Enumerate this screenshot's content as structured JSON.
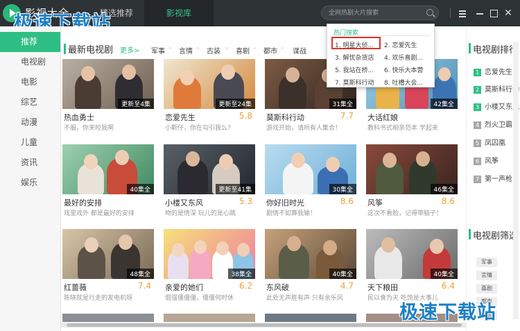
{
  "app": {
    "title": "影视大全"
  },
  "watermark": "极速下载站",
  "top_tabs": [
    "精选推荐",
    "影视库"
  ],
  "search": {
    "placeholder": "全网热剧大片搜索"
  },
  "sidebar": {
    "items": [
      {
        "label": "推荐",
        "active": true
      },
      {
        "label": "电视剧"
      },
      {
        "label": "电影"
      },
      {
        "label": "综艺"
      },
      {
        "label": "动漫"
      },
      {
        "label": "儿童"
      },
      {
        "label": "资讯"
      },
      {
        "label": "娱乐"
      }
    ]
  },
  "section": {
    "title": "最新电视剧",
    "more": "更多>",
    "filters": [
      "军事",
      "言情",
      "古装",
      "喜剧",
      "都市",
      "谍战"
    ],
    "filter_sep": "·"
  },
  "cards": [
    {
      "title": "热血勇士",
      "rating": "",
      "desc": "不服，你来咬我啊",
      "badge": "更新至4集"
    },
    {
      "title": "恋爱先生",
      "rating": "5.8",
      "desc": "小靳仔，你在勾引我么？",
      "badge": "更新至24集"
    },
    {
      "title": "莫斯科行动",
      "rating": "7.7",
      "desc": "游戏开始，请所有人集合！",
      "badge": "31集全"
    },
    {
      "title": "大话红娘",
      "rating": "",
      "desc": "教科书式相亲范本 学起来",
      "badge": "42集全"
    },
    {
      "title": "最好的安排",
      "rating": "",
      "desc": "戏里戏外 都是最好的安排",
      "badge": "40集全"
    },
    {
      "title": "小楼又东风",
      "rating": "5.3",
      "desc": "吻的是情深 玩儿的是心跳",
      "badge": "更新至41集"
    },
    {
      "title": "你好旧时光",
      "rating": "8.6",
      "desc": "剧情不如算我输！",
      "badge": "30集全"
    },
    {
      "title": "风筝",
      "rating": "8.6",
      "desc": "这次不看脸，记得带脑子！",
      "badge": "46集全"
    },
    {
      "title": "红蔷薇",
      "rating": "7.4",
      "desc": "陈晓就是行走的发电机呀",
      "badge": "48集全"
    },
    {
      "title": "亲爱的她们",
      "rating": "6.2",
      "desc": "倔强僵僵僵，僵僵何时休",
      "badge": "38集全"
    },
    {
      "title": "东风破",
      "rating": "4.7",
      "desc": "此处无声胜有声 只有余乐风",
      "badge": "40集全"
    },
    {
      "title": "天下粮田",
      "rating": "6.4",
      "desc": "民以食为天 吃饱是大事儿",
      "badge": "40集全"
    }
  ],
  "right_panel": {
    "rank_title": "电视剧排行",
    "rank_items": [
      "恋爱先生",
      "莫斯科行动",
      "小楼又东风",
      "烈火卫霸",
      "凤囚凰",
      "风筝",
      "第一声枪"
    ],
    "rank_hot_count": 3,
    "cat_title": "电视剧筛选",
    "tags": [
      "军事",
      "言情",
      "喜剧",
      "都市",
      "古装"
    ]
  },
  "dropdown": {
    "title": "热门搜索",
    "items": [
      "1. 明星大侦...",
      "2. 恋爱先生",
      "3. 解忧杂货店",
      "4. 欢乐喜剧...",
      "5. 我站在桥...",
      "6. 快乐大本营",
      "7. 莫斯科行动",
      "8. 吐槽大会..."
    ]
  },
  "colors": {
    "accent": "#2ebf85",
    "titlebar": "#2d3235",
    "rating": "#e8a23a",
    "highlight": "#d9342b"
  }
}
